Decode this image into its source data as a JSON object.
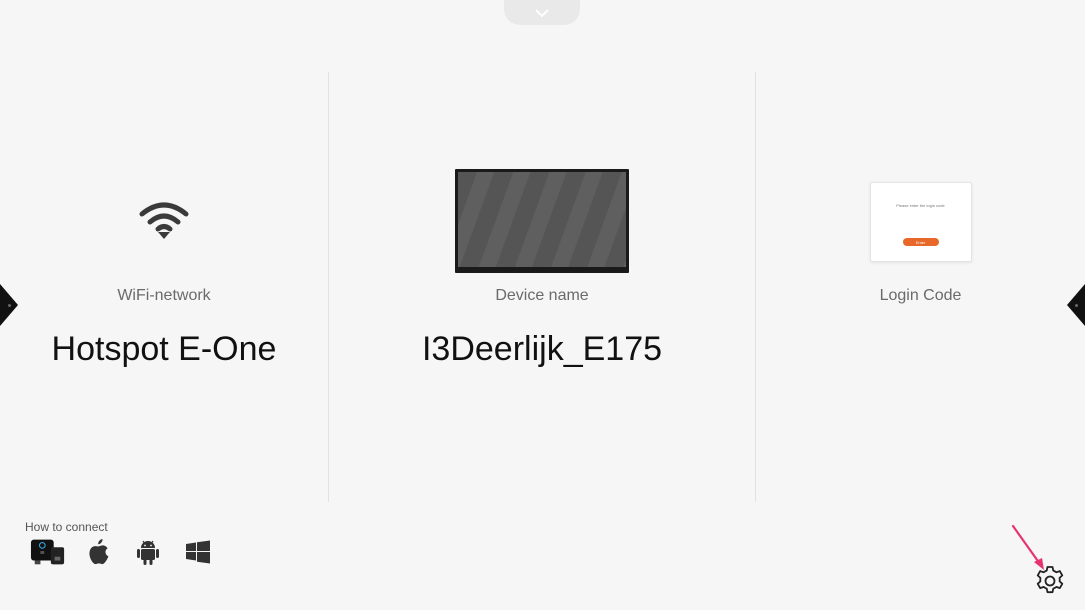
{
  "panels": {
    "wifi": {
      "label": "WiFi-network",
      "value": "Hotspot E-One"
    },
    "device": {
      "label": "Device name",
      "value": "I3Deerlijk_E175"
    },
    "login": {
      "label": "Login Code",
      "card_prompt": "Please enter the login code",
      "card_button": "Enter"
    }
  },
  "footer": {
    "how_to_connect": "How to connect",
    "platforms": [
      "byod-dongle-icon",
      "apple-icon",
      "android-icon",
      "windows-icon"
    ]
  },
  "icons": {
    "top": "chevron-down-icon",
    "settings": "gear-icon",
    "wifi": "wifi-icon"
  },
  "colors": {
    "background": "#f6f6f6",
    "accent": "#e8682a",
    "annotation": "#e8336d"
  }
}
